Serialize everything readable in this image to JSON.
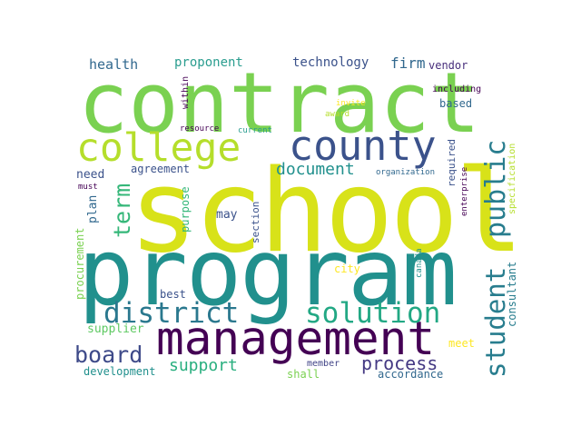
{
  "colors": {
    "dark_purple": "#440154",
    "blue": "#3b528b",
    "teal": "#21908d",
    "green": "#5ec962",
    "yellow": "#fde725",
    "lime": "#b5de2b",
    "steel": "#31688e",
    "deep_teal": "#287d8e"
  },
  "words": {
    "contract": "contract",
    "school": "school",
    "program": "program",
    "management": "management",
    "college": "college",
    "county": "county",
    "public": "public",
    "district": "district",
    "solution": "solution",
    "student": "student",
    "board": "board",
    "term": "term",
    "document": "document",
    "process": "process",
    "support": "support",
    "health": "health",
    "proponent": "proponent",
    "technology": "technology",
    "firm": "firm",
    "vendor": "vendor",
    "within": "within",
    "including": "including",
    "invite": "invite",
    "award": "award",
    "based": "based",
    "resource": "resource",
    "current": "current",
    "required": "required",
    "specification": "specification",
    "agreement": "agreement",
    "need": "need",
    "organization": "organization",
    "enterprise": "enterprise",
    "must": "must",
    "plan": "plan",
    "purpose": "purpose",
    "section": "section",
    "may": "may",
    "procurement": "procurement",
    "city": "city",
    "canada": "canada",
    "consultant": "consultant",
    "best": "best",
    "supplier": "supplier",
    "meet": "meet",
    "development": "development",
    "member": "member",
    "shall": "shall",
    "accordance": "accordance"
  }
}
